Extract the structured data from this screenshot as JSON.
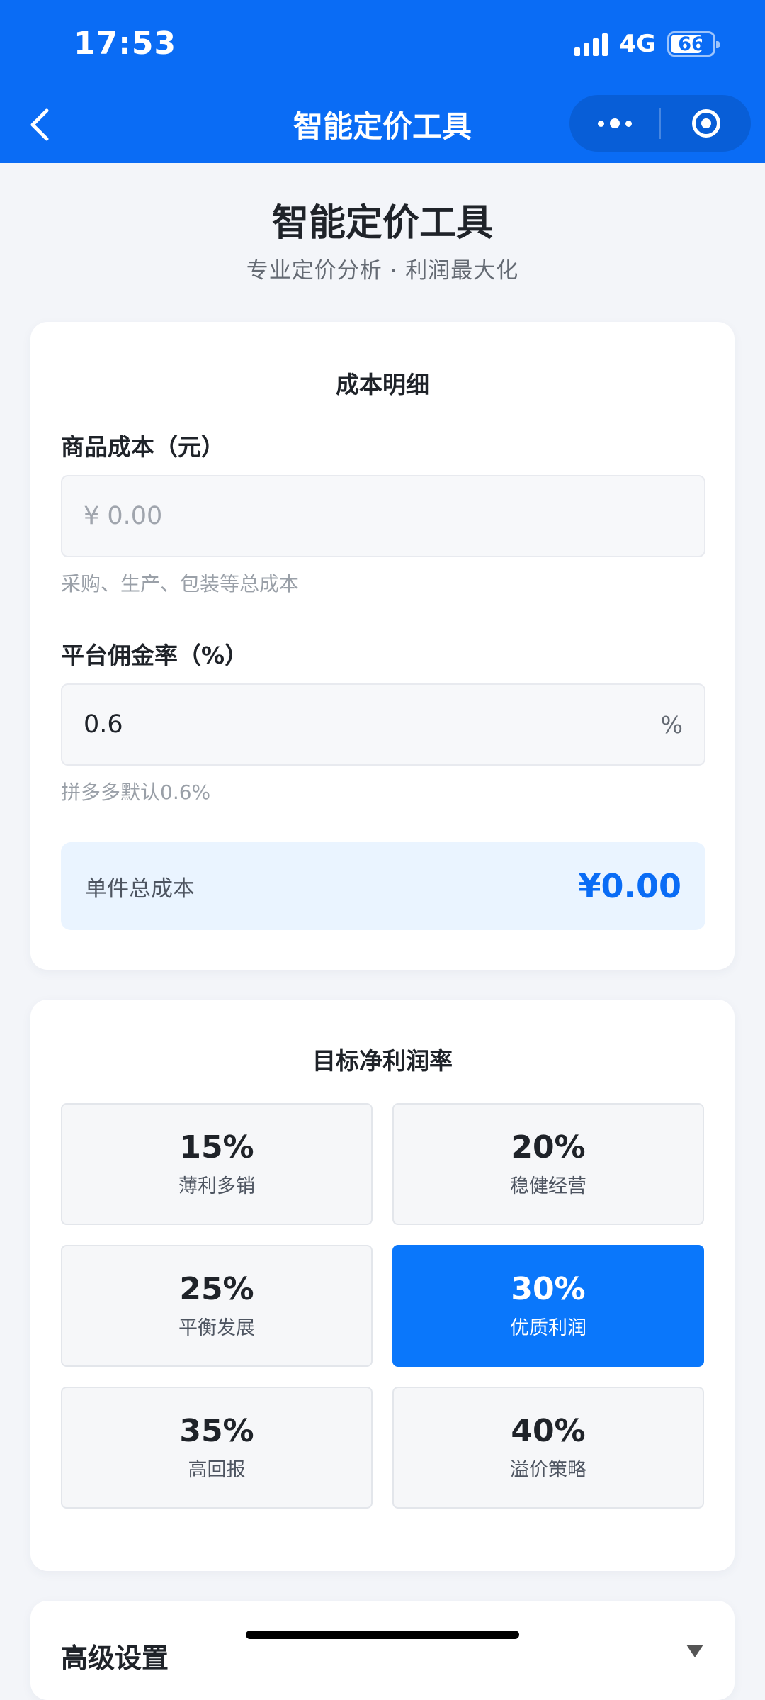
{
  "status_bar": {
    "time": "17:53",
    "network": "4G",
    "battery": "66"
  },
  "nav": {
    "title": "智能定价工具"
  },
  "page": {
    "title": "智能定价工具",
    "subtitle": "专业定价分析 · 利润最大化"
  },
  "cost_card": {
    "title": "成本明细",
    "product_cost": {
      "label": "商品成本（元）",
      "placeholder": "¥ 0.00",
      "value": "",
      "hint": "采购、生产、包装等总成本"
    },
    "commission": {
      "label": "平台佣金率（%）",
      "value": "0.6",
      "suffix": "%",
      "hint": "拼多多默认0.6%"
    },
    "total": {
      "label": "单件总成本",
      "value": "¥0.00"
    }
  },
  "profit_card": {
    "title": "目标净利润率",
    "selected_index": 3,
    "options": [
      {
        "pct": "15%",
        "desc": "薄利多销"
      },
      {
        "pct": "20%",
        "desc": "稳健经营"
      },
      {
        "pct": "25%",
        "desc": "平衡发展"
      },
      {
        "pct": "30%",
        "desc": "优质利润"
      },
      {
        "pct": "35%",
        "desc": "高回报"
      },
      {
        "pct": "40%",
        "desc": "溢价策略"
      }
    ]
  },
  "advanced": {
    "title": "高级设置"
  },
  "colors": {
    "primary": "#0a6cf5",
    "selected": "#0a77fb",
    "total_bg": "#eaf4ff",
    "page_bg": "#f3f5f9"
  }
}
